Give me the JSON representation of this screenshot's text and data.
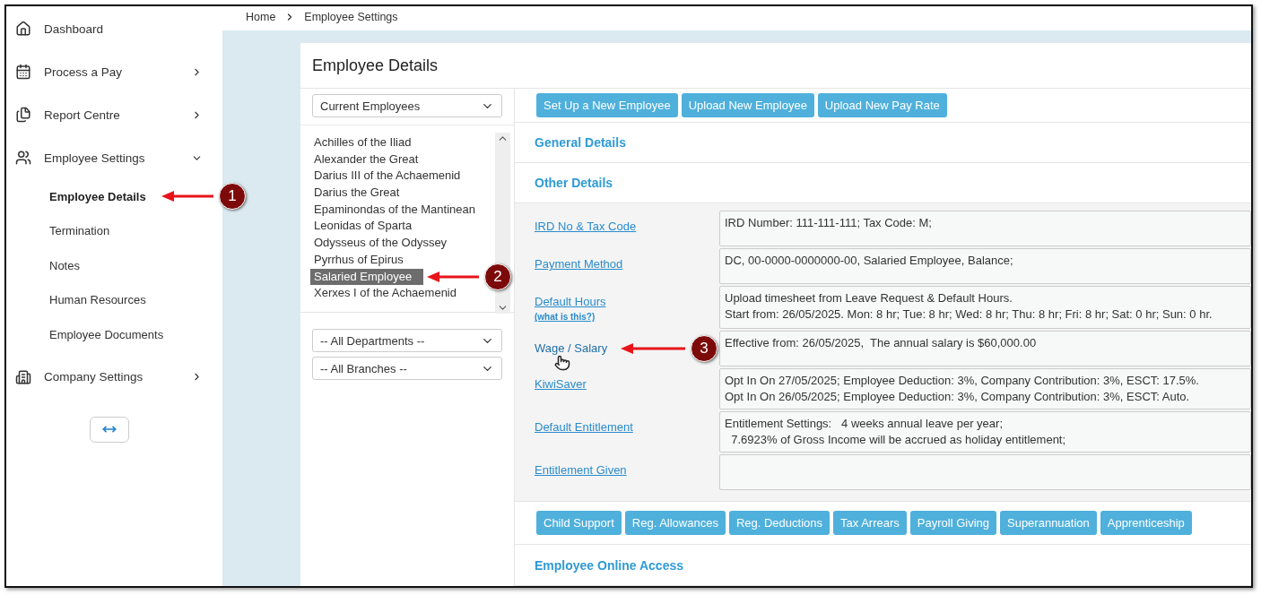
{
  "breadcrumb": [
    "Home",
    "Employee Settings"
  ],
  "sidebar": {
    "items": [
      {
        "label": "Dashboard",
        "kind": "link"
      },
      {
        "label": "Process a Pay",
        "kind": "menu",
        "expanded": false
      },
      {
        "label": "Report Centre",
        "kind": "menu",
        "expanded": false
      },
      {
        "label": "Employee Settings",
        "kind": "menu",
        "expanded": true,
        "children": [
          {
            "label": "Employee Details",
            "selected": true,
            "callout": "1"
          },
          {
            "label": "Termination",
            "selected": false
          },
          {
            "label": "Notes",
            "selected": false
          },
          {
            "label": "Human Resources",
            "selected": false
          },
          {
            "label": "Employee Documents",
            "selected": false
          }
        ]
      },
      {
        "label": "Company Settings",
        "kind": "menu",
        "expanded": false
      }
    ]
  },
  "card": {
    "title": "Employee Details",
    "employee_filter": "Current Employees",
    "employees": [
      {
        "name": "Achilles of the Iliad",
        "selected": false
      },
      {
        "name": "Alexander the Great",
        "selected": false
      },
      {
        "name": "Darius III of the Achaemenid",
        "selected": false
      },
      {
        "name": "Darius the Great",
        "selected": false
      },
      {
        "name": "Epaminondas of the Mantinean",
        "selected": false
      },
      {
        "name": "Leonidas of Sparta",
        "selected": false
      },
      {
        "name": "Odysseus of the Odyssey",
        "selected": false
      },
      {
        "name": "Pyrrhus of Epirus",
        "selected": false
      },
      {
        "name": "Salaried Employee",
        "selected": true,
        "callout": "2"
      },
      {
        "name": "Xerxes I of the Achaemenid",
        "selected": false
      }
    ],
    "department_filter": "-- All Departments --",
    "branch_filter": "-- All Branches --",
    "action_buttons": [
      "Set Up a New Employee",
      "Upload New Employee",
      "Upload New Pay Rate"
    ],
    "sections": [
      "General Details",
      "Other Details"
    ],
    "detail_rows": [
      {
        "label": "IRD No & Tax Code",
        "hovered": false,
        "lines": [
          "IRD Number: 111-111-111; Tax Code: M;"
        ]
      },
      {
        "label": "Payment Method",
        "hovered": false,
        "lines": [
          "DC, 00-0000-0000000-00, Salaried Employee, Balance;"
        ]
      },
      {
        "label": "Default Hours",
        "hint": "(what is this?)",
        "hovered": false,
        "lines": [
          "Upload timesheet from Leave Request & Default Hours.",
          "Start from: 26/05/2025. Mon: 8 hr; Tue: 8 hr; Wed: 8 hr; Thu: 8 hr; Fri: 8 hr; Sat: 0 hr; Sun: 0 hr."
        ]
      },
      {
        "label": "Wage / Salary",
        "hovered": true,
        "callout": "3",
        "lines": [
          "Effective from: 26/05/2025,  The annual salary is $60,000.00"
        ]
      },
      {
        "label": "KiwiSaver",
        "hovered": false,
        "lines": [
          "Opt In On 27/05/2025; Employee Deduction: 3%, Company Contribution: 3%, ESCT: 17.5%.",
          "Opt In On 26/05/2025; Employee Deduction: 3%, Company Contribution: 3%, ESCT: Auto."
        ]
      },
      {
        "label": "Default Entitlement",
        "hovered": false,
        "lines": [
          "Entitlement Settings:   4 weeks annual leave per year;",
          "  7.6923% of Gross Income will be accrued as holiday entitlement;"
        ]
      },
      {
        "label": "Entitlement Given",
        "hovered": false,
        "lines": []
      }
    ],
    "extra_buttons": [
      "Child Support",
      "Reg. Allowances",
      "Reg. Deductions",
      "Tax Arrears",
      "Payroll Giving",
      "Superannuation",
      "Apprenticeship"
    ],
    "footer_section": "Employee Online Access"
  }
}
